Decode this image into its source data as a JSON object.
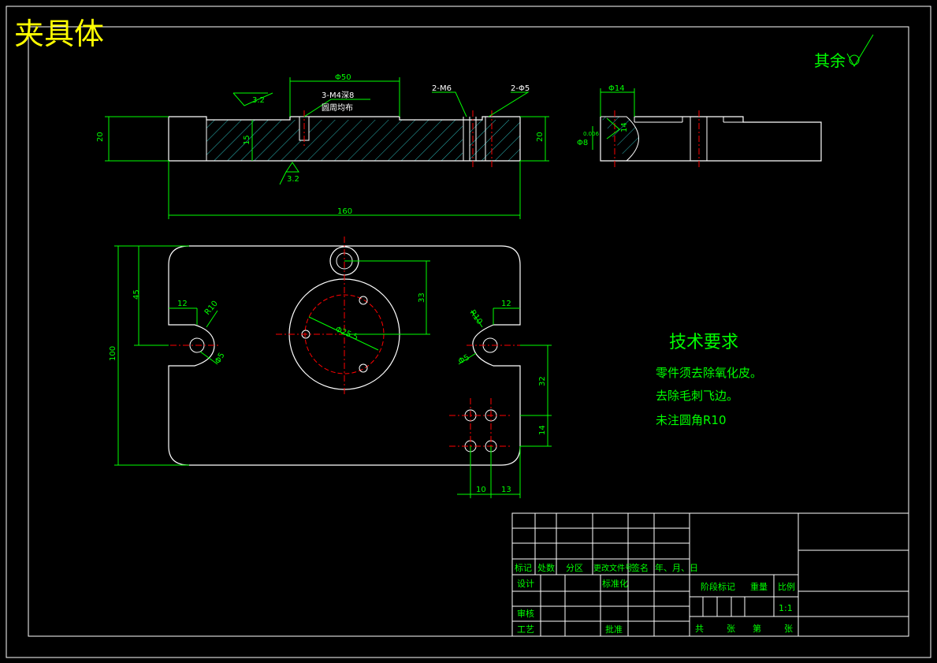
{
  "drawing": {
    "title": "夹具体",
    "surface_finish_note": "其余",
    "colors": {
      "background": "#000000",
      "outline": "#ffffff",
      "dimension": "#00ff00",
      "centerline": "#ff0000",
      "hatch": "#2bb5b5",
      "title": "#ffff00"
    }
  },
  "front_view": {
    "dim_phi50": "Φ50",
    "callout_thread_1": "3-M4深8",
    "callout_thread_2": "圆周均布",
    "callout_2m6": "2-M6",
    "callout_2phi5": "2-Φ5",
    "roughness_top": "3.2",
    "roughness_bottom": "3.2",
    "dim_height_left": "20",
    "dim_height_right": "20",
    "dim_depth": "15",
    "dim_length": "160"
  },
  "side_view": {
    "dim_phi14": "Φ14",
    "dim_phi8": "Φ8",
    "tol_upper": "0.006",
    "dim_14": "14"
  },
  "top_view": {
    "dim_45": "45",
    "dim_100": "100",
    "dim_12_left": "12",
    "dim_r10": "R10",
    "dim_phi5_left": "Φ5",
    "dim_33": "33",
    "dim_phi25": "Φ25.5",
    "dim_12_right": "12",
    "dim_r10_right": "R10",
    "dim_phi5_right": "Φ5",
    "dim_32": "32",
    "dim_14": "14",
    "dim_10": "10",
    "dim_13": "13"
  },
  "technical_requirements": {
    "heading": "技术要求",
    "items": [
      "零件须去除氧化皮。",
      "去除毛刺飞边。",
      "未注圆角R10"
    ]
  },
  "title_block": {
    "row_headers": [
      "标记",
      "处数",
      "分区",
      "更改文件号",
      "签名",
      "年、月、日"
    ],
    "design": "设计",
    "standardization": "标准化",
    "review": "审核",
    "process": "工艺",
    "approve": "批准",
    "stage_mark": "阶段标记",
    "weight": "重量",
    "scale": "比例",
    "scale_value": "1:1",
    "total": "共",
    "sheets": "张",
    "page": "第",
    "page_unit": "张"
  }
}
